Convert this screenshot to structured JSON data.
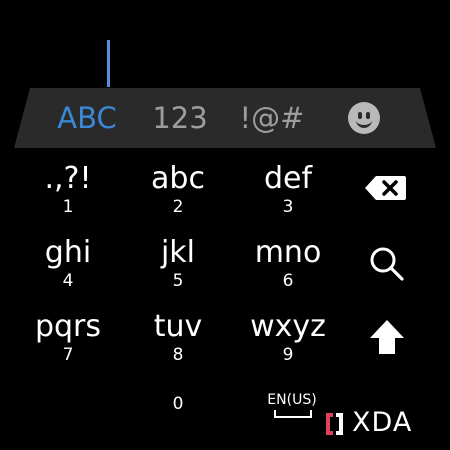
{
  "mode_tabs": {
    "letters": "ABC",
    "numbers": "123",
    "symbols": "!@#",
    "emoji_icon": "emoji-smiley-icon"
  },
  "keys": [
    {
      "main": ".,?!",
      "num": "1"
    },
    {
      "main": "abc",
      "num": "2"
    },
    {
      "main": "def",
      "num": "3"
    },
    {
      "main": "ghi",
      "num": "4"
    },
    {
      "main": "jkl",
      "num": "5"
    },
    {
      "main": "mno",
      "num": "6"
    },
    {
      "main": "pqrs",
      "num": "7"
    },
    {
      "main": "tuv",
      "num": "8"
    },
    {
      "main": "wxyz",
      "num": "9"
    }
  ],
  "zero_key": "0",
  "language": "EN(US)",
  "side_icons": [
    "backspace-icon",
    "search-icon",
    "shift-icon"
  ],
  "watermark": "XDA",
  "colors": {
    "accent": "#3b88d6",
    "inactive": "#9d9d9d",
    "bar": "#2a2a2a",
    "watermark_accent": "#e2415e"
  }
}
